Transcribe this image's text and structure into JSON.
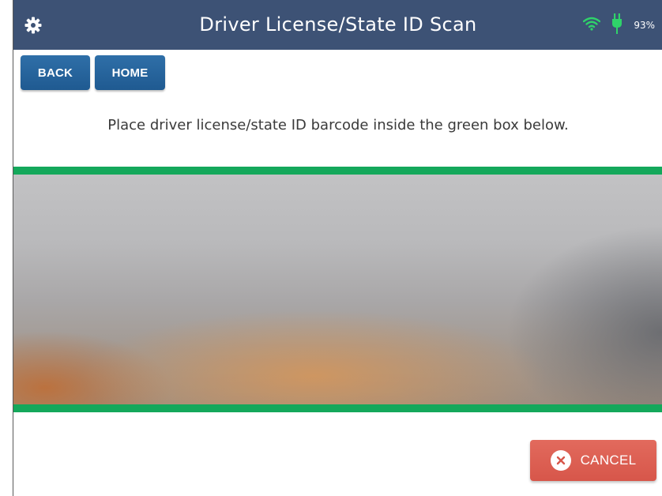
{
  "header": {
    "title": "Driver License/State ID Scan",
    "battery_text": "93%",
    "icons": [
      "gear-icon",
      "wifi-icon",
      "power-plug-icon"
    ]
  },
  "nav": {
    "back_label": "BACK",
    "home_label": "HOME"
  },
  "main": {
    "instruction": "Place driver license/state ID barcode inside the green box below."
  },
  "footer": {
    "cancel_label": "CANCEL",
    "cancel_icon": "close-icon"
  },
  "colors": {
    "header_bg": "#3d5275",
    "button_blue": "#1f5a91",
    "scan_border_green": "#14a85b",
    "cancel_red": "#d7564a",
    "status_green": "#2fd36a"
  }
}
